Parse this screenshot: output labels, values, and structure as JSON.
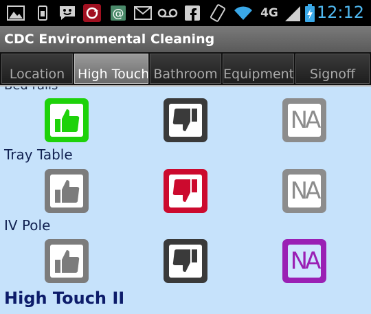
{
  "app": {
    "title": "CDC Environmental Cleaning"
  },
  "status": {
    "network": "4G",
    "time": "12:12"
  },
  "tabs": [
    {
      "label": "Location"
    },
    {
      "label": "High Touch I"
    },
    {
      "label": "Bathroom"
    },
    {
      "label": "Equipment"
    },
    {
      "label": "Signoff"
    }
  ],
  "rows": [
    {
      "label": "Bed rails",
      "selected": "up"
    },
    {
      "label": "Tray Table",
      "selected": "down"
    },
    {
      "label": "IV Pole",
      "selected": "na"
    }
  ],
  "section": {
    "next_title": "High Touch II"
  },
  "buttons": {
    "na_label": "NA"
  },
  "colors": {
    "up_selected": "#1ed20a",
    "down_selected": "#cc0a2e",
    "na_selected": "#9a20b4",
    "up_default": "#7c7c7c",
    "down_default": "#3a3a3a",
    "na_default": "#8c8c8c",
    "header_text": "#0d1c6a"
  }
}
